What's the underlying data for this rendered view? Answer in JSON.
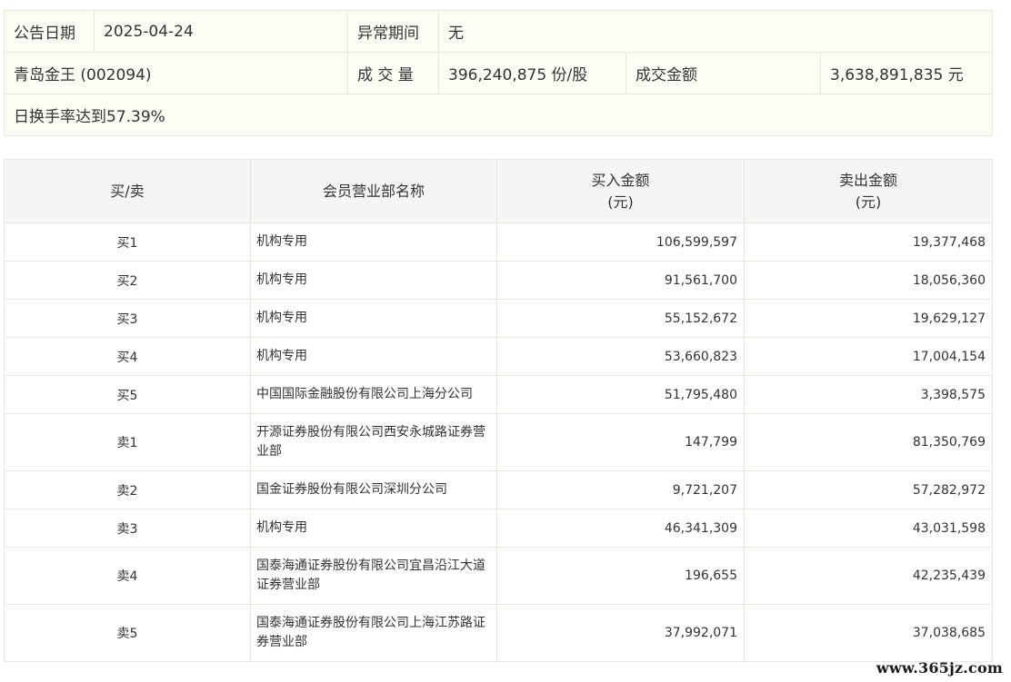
{
  "info": {
    "announce_date_label": "公告日期",
    "announce_date_value": "2025-04-24",
    "abnormal_period_label": "异常期间",
    "abnormal_period_value": "无",
    "stock_name": "青岛金王 (002094)",
    "volume_label": "成 交 量",
    "volume_value": "396,240,875 份/股",
    "amount_label": "成交金额",
    "amount_value": "3,638,891,835 元",
    "reason": "日换手率达到57.39%"
  },
  "table": {
    "headers": {
      "side": "买/卖",
      "member": "会员营业部名称",
      "buy_title": "买入金额",
      "buy_unit": "(元)",
      "sell_title": "卖出金额",
      "sell_unit": "(元)"
    },
    "rows": [
      {
        "side": "买1",
        "member": "机构专用",
        "buy": "106,599,597",
        "sell": "19,377,468"
      },
      {
        "side": "买2",
        "member": "机构专用",
        "buy": "91,561,700",
        "sell": "18,056,360"
      },
      {
        "side": "买3",
        "member": "机构专用",
        "buy": "55,152,672",
        "sell": "19,629,127"
      },
      {
        "side": "买4",
        "member": "机构专用",
        "buy": "53,660,823",
        "sell": "17,004,154"
      },
      {
        "side": "买5",
        "member": "中国国际金融股份有限公司上海分公司",
        "buy": "51,795,480",
        "sell": "3,398,575"
      },
      {
        "side": "卖1",
        "member": "开源证券股份有限公司西安永城路证券营业部",
        "buy": "147,799",
        "sell": "81,350,769"
      },
      {
        "side": "卖2",
        "member": "国金证券股份有限公司深圳分公司",
        "buy": "9,721,207",
        "sell": "57,282,972"
      },
      {
        "side": "卖3",
        "member": "机构专用",
        "buy": "46,341,309",
        "sell": "43,031,598"
      },
      {
        "side": "卖4",
        "member": "国泰海通证券股份有限公司宜昌沿江大道证券营业部",
        "buy": "196,655",
        "sell": "42,235,439"
      },
      {
        "side": "卖5",
        "member": "国泰海通证券股份有限公司上海江苏路证券营业部",
        "buy": "37,992,071",
        "sell": "37,038,685"
      }
    ]
  },
  "watermark": "www.365jz.com"
}
